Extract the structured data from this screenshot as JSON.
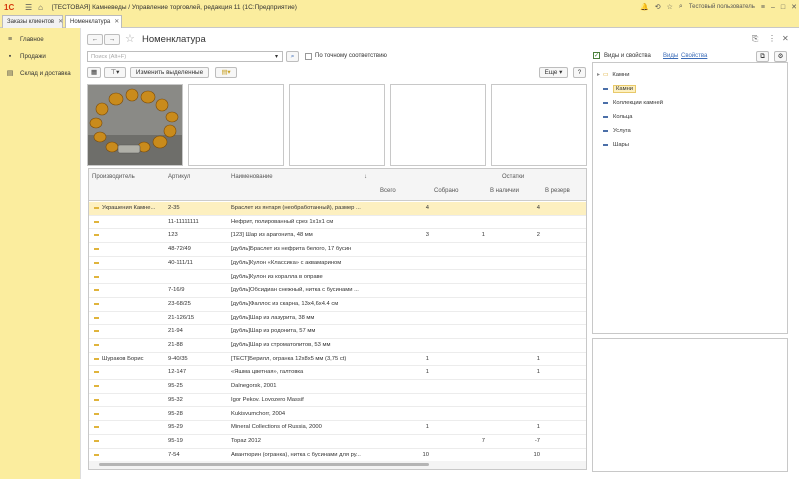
{
  "titlebar": {
    "logo": "1С",
    "title": "[ТЕСТОВАЯ] Камневеды / Управление торговлей, редакция 11  (1С:Предприятие)",
    "user": "Тестовый пользователь"
  },
  "tabs": [
    {
      "label": "Заказы клиентов"
    },
    {
      "label": "Номенклатура"
    }
  ],
  "sidebar": {
    "items": [
      {
        "label": "Главное",
        "icon": "menu-icon"
      },
      {
        "label": "Продажи",
        "icon": "sales-icon"
      },
      {
        "label": "Склад и доставка",
        "icon": "warehouse-icon"
      }
    ]
  },
  "page": {
    "title": "Номенклатура"
  },
  "search": {
    "placeholder": "Поиск (Alt+F)",
    "exact_match_label": "По точному соответствию",
    "exact_match_checked": false
  },
  "toolbar": {
    "change_selected": "Изменить выделенные",
    "more": "Еще",
    "help": "?"
  },
  "table": {
    "headers": {
      "manufacturer": "Производитель",
      "article": "Артикул",
      "name": "Наименование",
      "stock": "Остатки",
      "total": "Всего",
      "collected": "Собрано",
      "available": "В наличии",
      "reserve": "В резерв"
    },
    "rows": [
      {
        "manufacturer": "Украшения Камне...",
        "article": "2-35",
        "name": "Браслет из янтаря (необработанный), размер ...",
        "total": "4",
        "collected": "",
        "available": "4",
        "selected": true
      },
      {
        "manufacturer": "",
        "article": "11-11111111",
        "name": " Нефрит, полированный срез 1х1х1 см",
        "total": "",
        "collected": "",
        "available": ""
      },
      {
        "manufacturer": "",
        "article": "123",
        "name": "[123] Шар из арагонита, 48 мм",
        "total": "3",
        "collected": "1",
        "available": "2"
      },
      {
        "manufacturer": "",
        "article": "48-72/49",
        "name": "[дубль]Браслет из нефрита белого, 17 бусин",
        "total": "",
        "collected": "",
        "available": ""
      },
      {
        "manufacturer": "",
        "article": "40-111/11",
        "name": "[дубль]Кулон «Классика» с аквамарином",
        "total": "",
        "collected": "",
        "available": ""
      },
      {
        "manufacturer": "",
        "article": "",
        "name": "[дубль]Кулон из коралла в оправе",
        "total": "",
        "collected": "",
        "available": ""
      },
      {
        "manufacturer": "",
        "article": "7-16/9",
        "name": "[дубль]Обсидиан снежный, нитка с бусинами ...",
        "total": "",
        "collected": "",
        "available": ""
      },
      {
        "manufacturer": "",
        "article": "23-68/25",
        "name": "[дубль]Фаллос из скарна, 13х4,6х4.4 см",
        "total": "",
        "collected": "",
        "available": ""
      },
      {
        "manufacturer": "",
        "article": "21-126/15",
        "name": "[дубль]Шар из лазурита, 38 мм",
        "total": "",
        "collected": "",
        "available": ""
      },
      {
        "manufacturer": "",
        "article": "21-94",
        "name": "[дубль]Шар из родонита, 57 мм",
        "total": "",
        "collected": "",
        "available": ""
      },
      {
        "manufacturer": "",
        "article": "21-88",
        "name": "[дубль]Шар из строматолитов, 53 мм",
        "total": "",
        "collected": "",
        "available": ""
      },
      {
        "manufacturer": "Шураков Борис",
        "article": "9-40/35",
        "name": "[ТЕСТ]Берилл, огранка 12х8х5 мм (3,75 ct)",
        "total": "1",
        "collected": "",
        "available": "1"
      },
      {
        "manufacturer": "",
        "article": "12-147",
        "name": "«Яшма цветная», галтовка",
        "total": "1",
        "collected": "",
        "available": "1"
      },
      {
        "manufacturer": "",
        "article": "95-25",
        "name": "Dalnegorsk, 2001",
        "total": "",
        "collected": "",
        "available": ""
      },
      {
        "manufacturer": "",
        "article": "95-32",
        "name": "Igor Pekov. Lovozero Massif",
        "total": "",
        "collected": "",
        "available": ""
      },
      {
        "manufacturer": "",
        "article": "95-28",
        "name": "Kukisvumchorr, 2004",
        "total": "",
        "collected": "",
        "available": ""
      },
      {
        "manufacturer": "",
        "article": "95-29",
        "name": "Mineral Collections of Russia, 2000",
        "total": "1",
        "collected": "",
        "available": "1"
      },
      {
        "manufacturer": "",
        "article": "95-19",
        "name": "Topaz 2012",
        "total": "",
        "collected": "7",
        "available": "-7"
      },
      {
        "manufacturer": "",
        "article": "7-54",
        "name": "Авантюрин (огранка), нитка с бусинами для ру...",
        "total": "10",
        "collected": "",
        "available": "10"
      }
    ]
  },
  "rightpanel": {
    "checkbox_label": "Виды и свойства",
    "checked": true,
    "link_types": "Виды",
    "link_props": "Свойства",
    "tree_root": "Камни",
    "tree_items": [
      "Камни",
      "Коллекции камней",
      "Кольца",
      "Услуга",
      "Шары"
    ]
  },
  "colors": {
    "accent": "#fbed9e",
    "selected_row": "#fdf0c0",
    "link": "#3b6cb8"
  }
}
